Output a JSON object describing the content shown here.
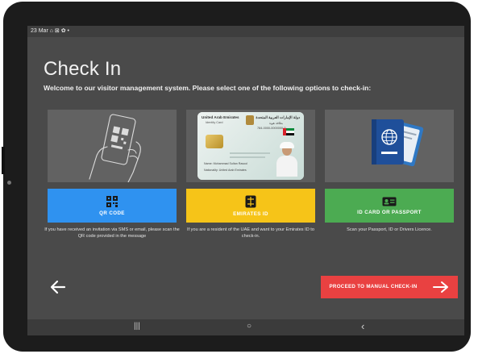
{
  "status_bar": {
    "text": "23 Mar  ⌂ ⊠ ✿ •"
  },
  "page": {
    "title": "Check In",
    "subtitle": "Welcome to our visitor management system. Please select one of the following options to check-in:"
  },
  "options": [
    {
      "label": "QR CODE",
      "color": "#2f92f0",
      "icon": "qr-code-icon",
      "description": "If you have received an invitation via SMS or email, please scan the QR code provided in the message"
    },
    {
      "label": "EMIRATES ID",
      "color": "#f6c418",
      "icon": "sim-chip-icon",
      "description": "If you are a resident of the UAE and want to your Emirates ID to check-in."
    },
    {
      "label": "ID CARD OR PASSPORT",
      "color": "#4cab52",
      "icon": "id-card-icon",
      "description": "Scan your Passport, ID or Drivers Licence."
    }
  ],
  "id_card": {
    "header_left": "United Arab Emirates",
    "header_left_2": "Identity Card",
    "header_right": "دولة الإمارات العربية المتحدة",
    "header_right_2": "بطاقة هوية",
    "id_number": "784-0000-0000000-0",
    "name_line": "Name: Mohammad Sultan Rasool",
    "nationality_line": "Nationality: United Arab Emirates"
  },
  "actions": {
    "back_icon": "arrow-left-icon",
    "manual_label": "PROCEED TO MANUAL CHECK-IN",
    "manual_color": "#e94141",
    "manual_icon": "arrow-right-icon"
  },
  "nav_bar": {
    "recents": "|||",
    "home": "○",
    "back": "‹"
  }
}
